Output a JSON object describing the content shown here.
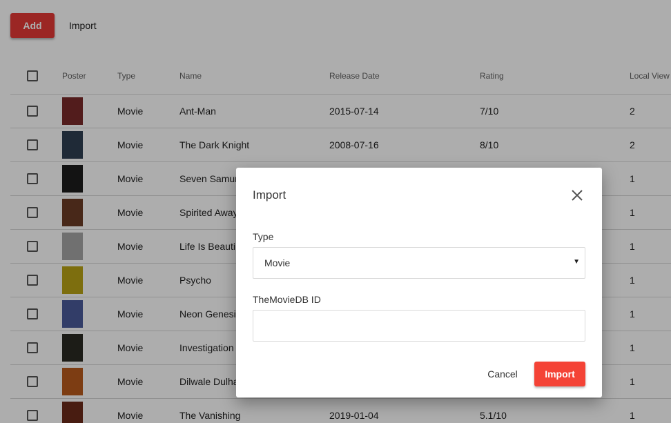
{
  "toolbar": {
    "add_label": "Add",
    "import_label": "Import"
  },
  "table": {
    "headers": {
      "poster": "Poster",
      "type": "Type",
      "name": "Name",
      "release_date": "Release Date",
      "rating": "Rating",
      "local_views": "Local View"
    },
    "rows": [
      {
        "type": "Movie",
        "name": "Ant-Man",
        "release_date": "2015-07-14",
        "rating": "7/10",
        "local_views": "2",
        "poster_color": "#7a2a2a"
      },
      {
        "type": "Movie",
        "name": "The Dark Knight",
        "release_date": "2008-07-16",
        "rating": "8/10",
        "local_views": "2",
        "poster_color": "#2e3f52"
      },
      {
        "type": "Movie",
        "name": "Seven Samur",
        "release_date": "",
        "rating": "",
        "local_views": "1",
        "poster_color": "#1c1c1c"
      },
      {
        "type": "Movie",
        "name": "Spirited Away",
        "release_date": "",
        "rating": "",
        "local_views": "1",
        "poster_color": "#6b3b25"
      },
      {
        "type": "Movie",
        "name": "Life Is Beauti",
        "release_date": "",
        "rating": "",
        "local_views": "1",
        "poster_color": "#a6a6a6"
      },
      {
        "type": "Movie",
        "name": "Psycho",
        "release_date": "",
        "rating": "",
        "local_views": "1",
        "poster_color": "#b8a316"
      },
      {
        "type": "Movie",
        "name": "Neon Genesis of Evangelion",
        "release_date": "",
        "rating": "",
        "local_views": "1",
        "poster_color": "#4a5a9a"
      },
      {
        "type": "Movie",
        "name": "Investigation Suspicion",
        "release_date": "",
        "rating": "",
        "local_views": "1",
        "poster_color": "#2a2a22"
      },
      {
        "type": "Movie",
        "name": "Dilwale Dulha",
        "release_date": "",
        "rating": "",
        "local_views": "1",
        "poster_color": "#b85a1c"
      },
      {
        "type": "Movie",
        "name": "The Vanishing",
        "release_date": "2019-01-04",
        "rating": "5.1/10",
        "local_views": "1",
        "poster_color": "#6a2a1a"
      }
    ]
  },
  "dialog": {
    "title": "Import",
    "type_label": "Type",
    "type_value": "Movie",
    "id_label": "TheMovieDB ID",
    "id_value": "",
    "cancel_label": "Cancel",
    "import_label": "Import"
  },
  "colors": {
    "accent": "#f44336",
    "backdrop": "rgba(0,0,0,0.32)"
  }
}
